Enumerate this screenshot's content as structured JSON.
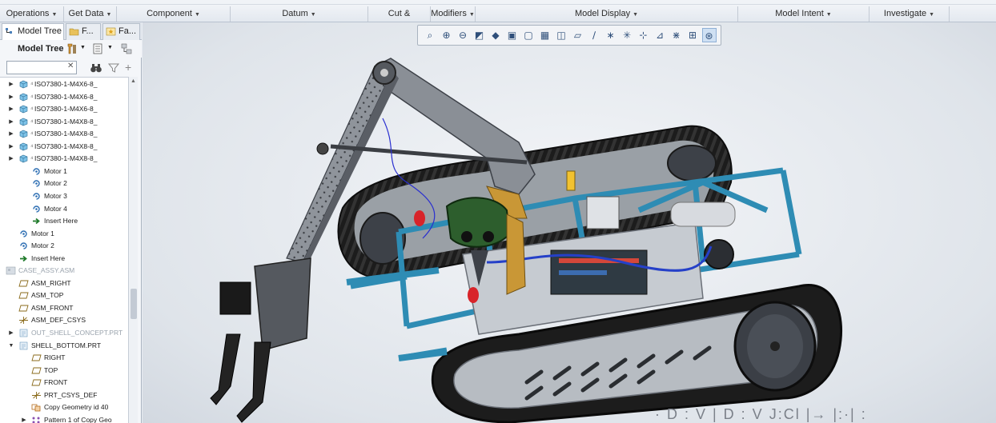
{
  "ribbon": {
    "groups": [
      "Operations",
      "Get Data",
      "Component",
      "Datum",
      "Cut & Surface",
      "Modifiers",
      "Model Display",
      "Model Intent",
      "Investigate"
    ]
  },
  "panel": {
    "tabs": [
      "Model Tree",
      "F...",
      "Fa..."
    ],
    "title": "Model Tree",
    "filter_value": "",
    "tree_rows": [
      {
        "label": "ISO7380-1-M4X6-8_",
        "type": "part"
      },
      {
        "label": "ISO7380-1-M4X6-8_",
        "type": "part"
      },
      {
        "label": "ISO7380-1-M4X6-8_",
        "type": "part"
      },
      {
        "label": "ISO7380-1-M4X8-8_",
        "type": "part"
      },
      {
        "label": "ISO7380-1-M4X8-8_",
        "type": "part"
      },
      {
        "label": "ISO7380-1-M4X8-8_",
        "type": "part"
      },
      {
        "label": "ISO7380-1-M4X8-8_",
        "type": "part"
      },
      {
        "label": "Motor 1",
        "type": "motor"
      },
      {
        "label": "Motor 2",
        "type": "motor"
      },
      {
        "label": "Motor 3",
        "type": "motor"
      },
      {
        "label": "Motor 4",
        "type": "motor"
      },
      {
        "label": "Insert Here",
        "type": "insert"
      },
      {
        "label": "Motor 1",
        "type": "motor"
      },
      {
        "label": "Motor 2",
        "type": "motor"
      },
      {
        "label": "Insert Here",
        "type": "insert"
      },
      {
        "label": "CASE_ASSY.ASM",
        "type": "asm"
      },
      {
        "label": "ASM_RIGHT",
        "type": "plane"
      },
      {
        "label": "ASM_TOP",
        "type": "plane"
      },
      {
        "label": "ASM_FRONT",
        "type": "plane"
      },
      {
        "label": "ASM_DEF_CSYS",
        "type": "csys"
      },
      {
        "label": "OUT_SHELL_CONCEPT.PRT",
        "type": "prt"
      },
      {
        "label": "SHELL_BOTTOM.PRT",
        "type": "prt"
      },
      {
        "label": "RIGHT",
        "type": "plane"
      },
      {
        "label": "TOP",
        "type": "plane"
      },
      {
        "label": "FRONT",
        "type": "plane"
      },
      {
        "label": "PRT_CSYS_DEF",
        "type": "csys"
      },
      {
        "label": "Copy Geometry id 40",
        "type": "copy"
      },
      {
        "label": "Pattern 1 of Copy Geo",
        "type": "pattern"
      }
    ]
  },
  "graphics_toolbar": {
    "icons": [
      "refit-icon",
      "zoom-in-icon",
      "zoom-out-icon",
      "repaint-icon",
      "display-style-icon",
      "saved-orientations-icon",
      "view-manager-icon",
      "perspective-icon",
      "annotation-display-icon",
      "plane-display-icon",
      "axis-display-icon",
      "point-display-icon",
      "csys-display-icon",
      "spin-center-icon",
      "annotation-icon",
      "point-tag-icon",
      "csys-tag-icon",
      "spin-center-display-icon"
    ]
  },
  "viewport": {
    "watermark": "·  D : V    | D : V J:Cl |→ |:·| :"
  },
  "colors": {
    "frame_blue": "#2e8cb4",
    "track_black": "#1c1c1c",
    "arm_gray": "#8a8f96",
    "plate_gray": "#b9bec4",
    "accent_red": "#d8242a",
    "camera_green": "#2d5e2d"
  }
}
